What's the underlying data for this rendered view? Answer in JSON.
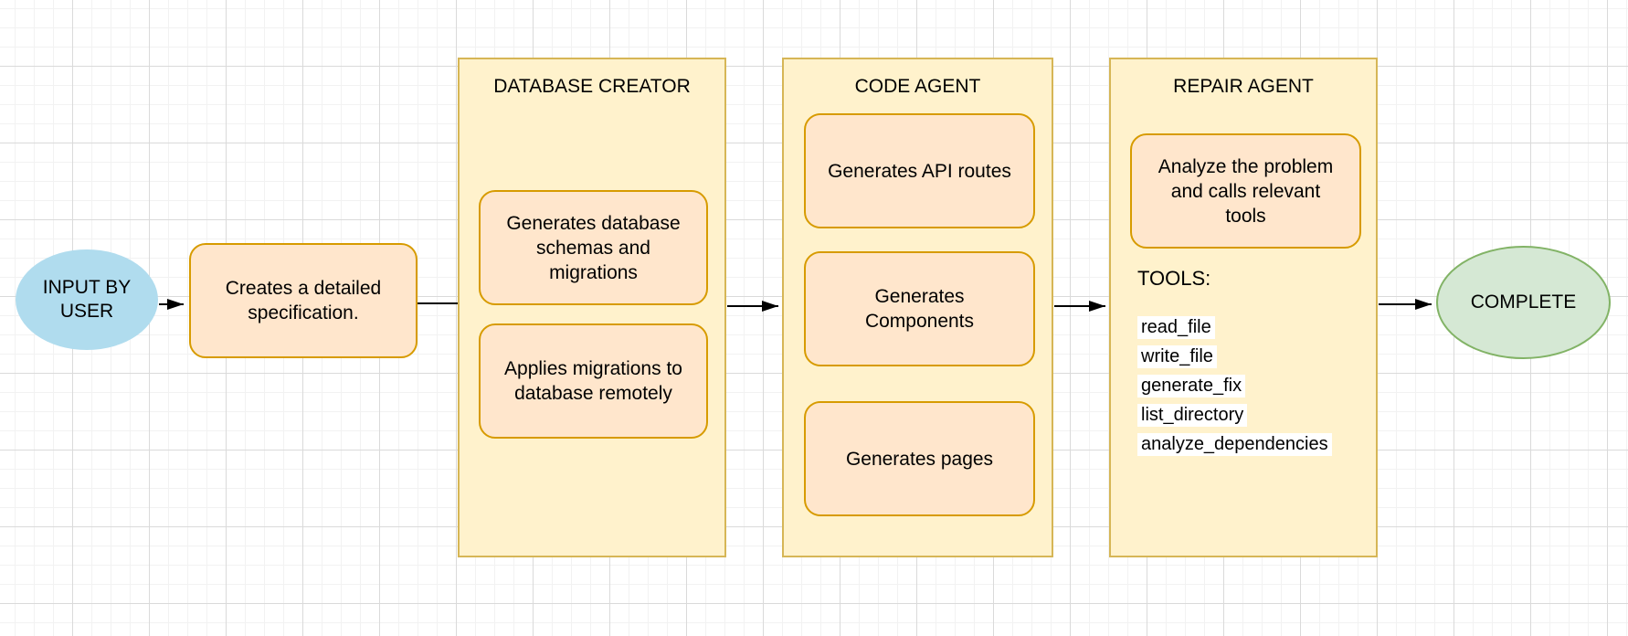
{
  "colors": {
    "container_fill": "#fff2cc",
    "container_border": "#d6b656",
    "step_fill": "#ffe6cc",
    "step_border": "#d79b00",
    "start_fill": "#b0dcee",
    "end_fill": "#d5e8d4",
    "end_border": "#82b366",
    "connector": "#000000",
    "text": "#000000"
  },
  "nodes": {
    "input": {
      "label": "INPUT BY\nUSER"
    },
    "spec": {
      "label": "Creates a detailed\nspecification."
    },
    "database_creator": {
      "title": "DATABASE CREATOR",
      "steps": [
        "Generates database\nschemas and\nmigrations",
        "Applies migrations to\ndatabase remotely"
      ]
    },
    "code_agent": {
      "title": "CODE AGENT",
      "steps": [
        "Generates API routes",
        "Generates\nComponents",
        "Generates pages"
      ]
    },
    "repair_agent": {
      "title": "REPAIR AGENT",
      "steps": [
        "Analyze the problem\nand calls relevant\ntools"
      ],
      "tools_label": "TOOLS:",
      "tools": [
        "read_file",
        "write_file",
        "generate_fix",
        "list_directory",
        "analyze_dependencies"
      ]
    },
    "complete": {
      "label": "COMPLETE"
    }
  }
}
